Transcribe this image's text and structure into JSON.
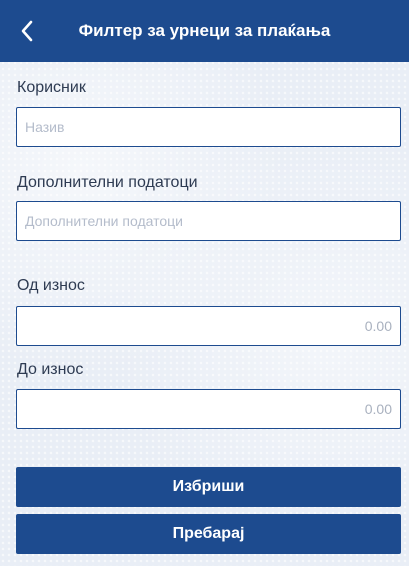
{
  "header": {
    "title": "Филтер за урнеци за плаќања"
  },
  "form": {
    "user": {
      "label": "Корисник",
      "value": "",
      "placeholder": "Назив"
    },
    "additional": {
      "label": "Дополнителни податоци",
      "value": "",
      "placeholder": "Дополнителни податоци"
    },
    "amount_from": {
      "label": "Од износ",
      "value": "",
      "placeholder": "0.00"
    },
    "amount_to": {
      "label": "До износ",
      "value": "",
      "placeholder": "0.00"
    }
  },
  "actions": {
    "clear_label": "Избриши",
    "search_label": "Пребарај"
  },
  "colors": {
    "primary": "#1d4b8f",
    "background": "#e9eef6"
  },
  "icons": {
    "back": "chevron-left-icon"
  }
}
